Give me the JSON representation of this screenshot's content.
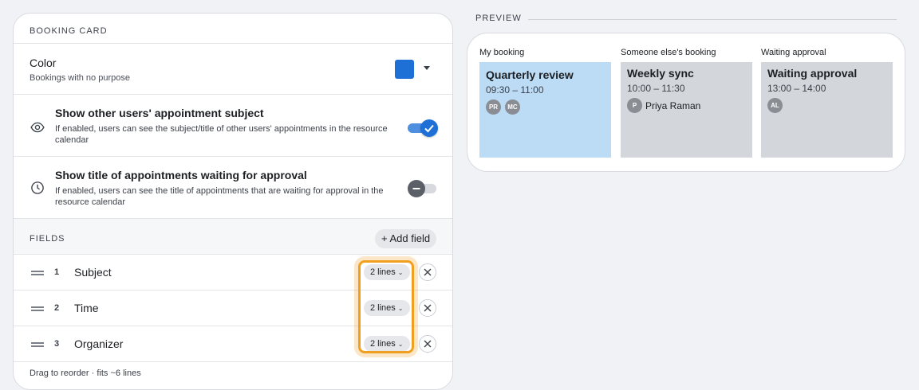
{
  "booking_card": {
    "header": "BOOKING CARD",
    "color": {
      "title": "Color",
      "subtitle": "Bookings with no purpose",
      "value": "#1e6fd6"
    },
    "show_subject": {
      "title": "Show other users' appointment subject",
      "description": "If enabled, users can see the subject/title of other users' appointments in the resource calendar",
      "enabled": true
    },
    "show_waiting": {
      "title": "Show title of appointments waiting for approval",
      "description": "If enabled, users can see the title of appointments that are waiting for approval in the resource calendar",
      "enabled": false
    }
  },
  "fields": {
    "header": "FIELDS",
    "add_label": "+ Add field",
    "items": [
      {
        "index": "1",
        "name": "Subject",
        "lines": "2 lines"
      },
      {
        "index": "2",
        "name": "Time",
        "lines": "2 lines"
      },
      {
        "index": "3",
        "name": "Organizer",
        "lines": "2 lines"
      }
    ],
    "footer": "Drag to reorder · fits ~6 lines"
  },
  "preview": {
    "label": "PREVIEW",
    "columns": [
      {
        "label": "My booking",
        "title": "Quarterly review",
        "time": "09:30 – 11:00",
        "avatars": [
          "PR",
          "MC"
        ],
        "background": "#bcdcf6"
      },
      {
        "label": "Someone else's booking",
        "title": "Weekly sync",
        "time": "10:00 – 11:30",
        "avatar": "P",
        "organizer": "Priya Raman",
        "background": "#d3d7db"
      },
      {
        "label": "Waiting approval",
        "title": "Waiting approval",
        "time": "13:00 – 14:00",
        "avatars": [
          "AL"
        ],
        "background": "#d3d7db"
      }
    ]
  }
}
